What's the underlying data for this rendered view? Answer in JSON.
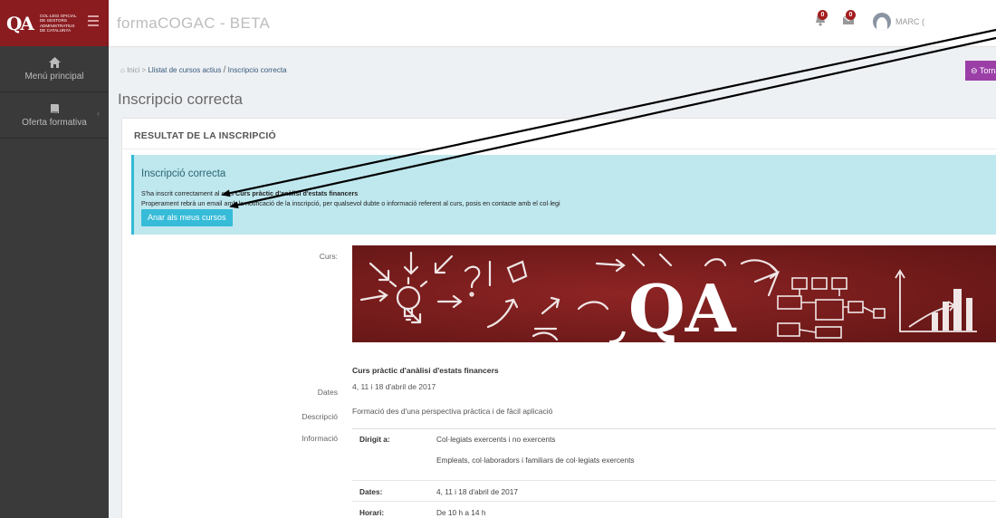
{
  "brand": {
    "logo": "QA",
    "lines": [
      "Col·legi Oficial",
      "de Gestors",
      "Administratius",
      "de Catalunya"
    ]
  },
  "sidebar": {
    "items": [
      {
        "label": "Menú principal",
        "icon": "home-icon"
      },
      {
        "label": "Oferta formativa",
        "icon": "book-icon"
      }
    ]
  },
  "header": {
    "app_title": "formaCOGAC - BETA",
    "notifications_badge": "0",
    "messages_badge": "0",
    "user_name": "MARC ("
  },
  "breadcrumb": {
    "home": "Inici",
    "sep1": ">",
    "link": "Llistat de cursos actius",
    "sep2": "/",
    "current": "Inscripcio correcta"
  },
  "back_button": "Tornar",
  "page_title": "Inscripcio correcta",
  "panel_title": "RESULTAT DE LA INSCRIPCIÓ",
  "alert": {
    "title": "Inscripció correcta",
    "line1_prefix": "S'ha inscrit correctament al curs",
    "line1_course": "Curs pràctic d'anàlisi d'estats financers",
    "line2": "Properament rebrà un email amb la notificació de la inscripció, per qualsevol dubte o informació referent al curs, posis en contacte amb el col·legi",
    "button": "Anar als meus cursos"
  },
  "course": {
    "label_curs": "Curs:",
    "name": "Curs pràctic d'anàlisi d'estats financers",
    "label_dates": "Dates",
    "dates": "4, 11 i 18 d'abril de 2017",
    "label_desc": "Descripció",
    "description": "Formació des d'una perspectiva pràctica i de fàcil aplicació",
    "label_info": "Informació"
  },
  "info_table": {
    "rows": [
      {
        "key": "Dirigit a:",
        "value": "Col·legiats exercents i no exercents"
      },
      {
        "key": "",
        "value": "Empleats, col·laboradors i familiars de col·legiats exercents"
      },
      {
        "key": "Dates:",
        "value": "4, 11 i 18 d'abril de 2017"
      },
      {
        "key": "Horari:",
        "value": "De 10 h a 14 h"
      }
    ]
  },
  "colors": {
    "brand": "#8a1c20",
    "sidebar": "#3a3a3a",
    "alert_bg": "#bfe7ee",
    "alert_button": "#36bcd8",
    "back_button": "#9b3fa7",
    "banner": "#7a1c1c"
  }
}
